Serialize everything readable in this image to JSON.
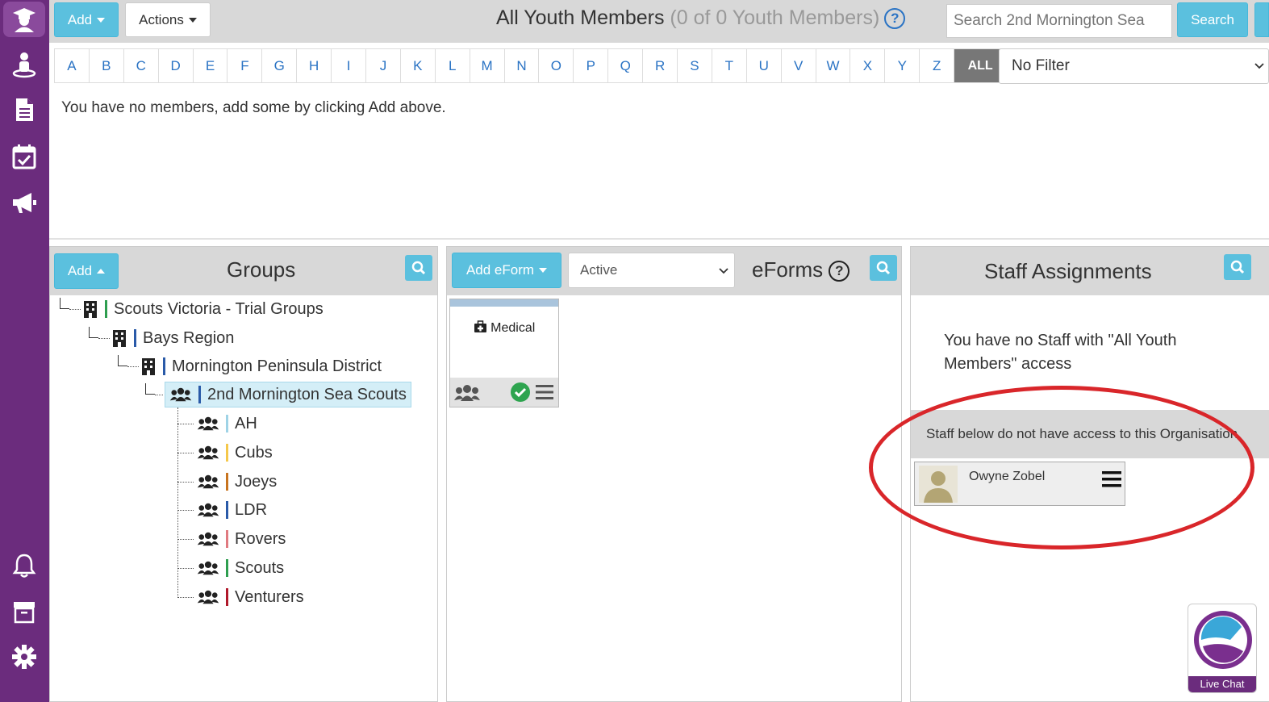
{
  "toolbar": {
    "add_label": "Add",
    "actions_label": "Actions",
    "title": "All Youth Members",
    "title_count": "(0 of 0 Youth Members)",
    "search_placeholder": "Search 2nd Mornington Sea",
    "search_label": "Search"
  },
  "alphabet": [
    "A",
    "B",
    "C",
    "D",
    "E",
    "F",
    "G",
    "H",
    "I",
    "J",
    "K",
    "L",
    "M",
    "N",
    "O",
    "P",
    "Q",
    "R",
    "S",
    "T",
    "U",
    "V",
    "W",
    "X",
    "Y",
    "Z"
  ],
  "alphabet_all": "ALL",
  "filter": {
    "selected": "No Filter"
  },
  "members": {
    "empty_message": "You have no members, add some by clicking Add above."
  },
  "groups_panel": {
    "add_label": "Add",
    "title": "Groups",
    "tree": [
      {
        "label": "Scouts Victoria - Trial Groups",
        "icon": "building-icon",
        "color": "#2e9e4f"
      },
      {
        "label": "Bays Region",
        "icon": "building-icon",
        "color": "#2a5aa8"
      },
      {
        "label": "Mornington Peninsula District",
        "icon": "building-icon",
        "color": "#2a5aa8"
      },
      {
        "label": "2nd Mornington Sea Scouts",
        "icon": "users-icon",
        "color": "#2a5aa8",
        "selected": true
      },
      {
        "label": "AH",
        "icon": "users-icon",
        "color": "#9fd3e6"
      },
      {
        "label": "Cubs",
        "icon": "users-icon",
        "color": "#f5c84b"
      },
      {
        "label": "Joeys",
        "icon": "users-icon",
        "color": "#c8741f"
      },
      {
        "label": "LDR",
        "icon": "users-icon",
        "color": "#2a5aa8"
      },
      {
        "label": "Rovers",
        "icon": "users-icon",
        "color": "#e07a80"
      },
      {
        "label": "Scouts",
        "icon": "users-icon",
        "color": "#2e9e4f"
      },
      {
        "label": "Venturers",
        "icon": "users-icon",
        "color": "#b0182a"
      }
    ]
  },
  "eforms_panel": {
    "add_label": "Add eForm",
    "status_selected": "Active",
    "title": "eForms",
    "cards": [
      {
        "label": "Medical",
        "icon": "medkit-icon"
      }
    ]
  },
  "staff_panel": {
    "title": "Staff Assignments",
    "no_staff_message": "You have no Staff with \"All Youth Members\" access",
    "banner": "Staff below do not have access to this Organisation",
    "staff": [
      {
        "name": "Owyne Zobel"
      }
    ]
  },
  "live_chat": {
    "label": "Live Chat"
  },
  "colors": {
    "sidebar": "#6b2c7d",
    "accent": "#5bc0de",
    "annotation": "#d9262a"
  }
}
